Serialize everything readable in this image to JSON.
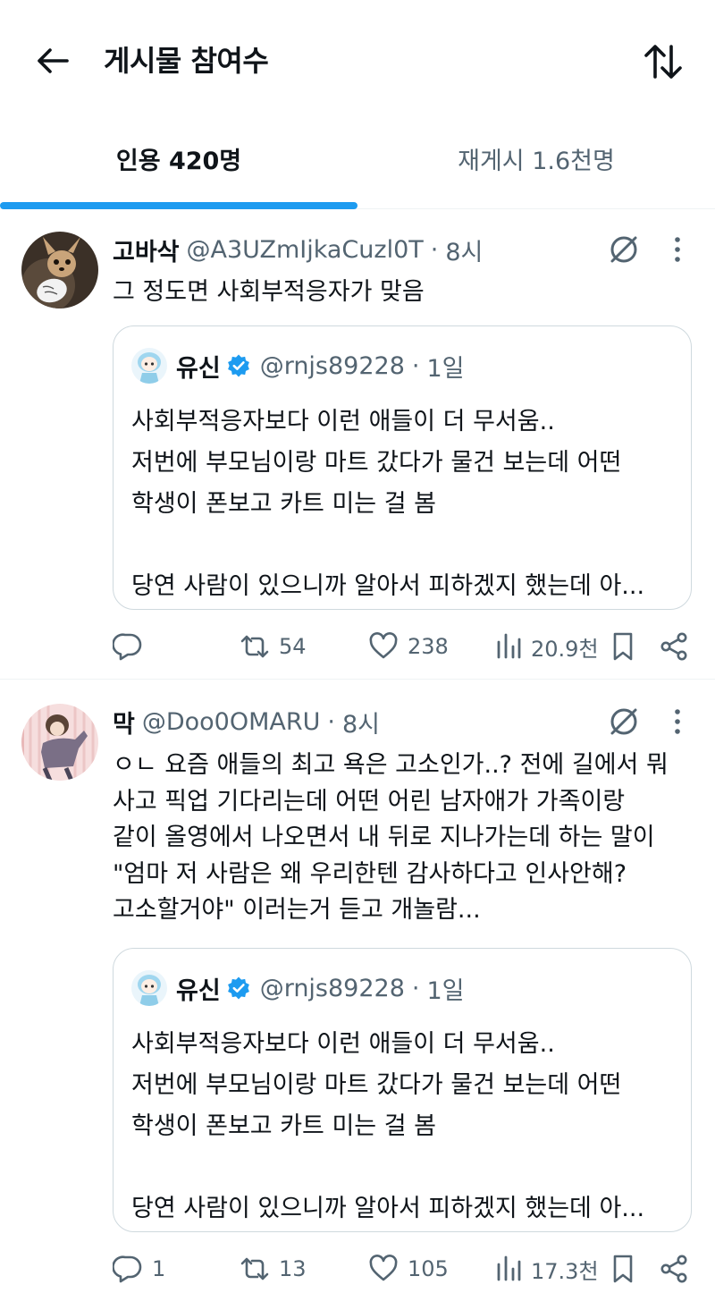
{
  "header": {
    "title": "게시물 참여수",
    "back_icon": "arrow-left-icon",
    "sort_icon": "sort-arrows-icon"
  },
  "tabs": [
    {
      "label": "인용 420명",
      "active": true
    },
    {
      "label": "재게시 1.6천명",
      "active": false
    }
  ],
  "colors": {
    "accent": "#1d9bf0",
    "text_primary": "#0f1419",
    "text_secondary": "#536471",
    "border": "#cfd9de",
    "verified": "#1d9bf0"
  },
  "posts": [
    {
      "name": "고바삭",
      "handle": "@A3UZmIjkaCuzl0T",
      "sep": "·",
      "time": "8시",
      "text": "그 정도면 사회부적응자가 맞음",
      "quote": {
        "name": "유신",
        "verified": true,
        "handle": "@rnjs89228",
        "sep": "·",
        "time": "1일",
        "text": "사회부적응자보다 이런 애들이 더 무서움..\n저번에 부모님이랑 마트 갔다가 물건 보는데 어떤\n학생이 폰보고 카트 미는 걸 봄\n\n당연 사람이 있으니까 알아서 피하겠지 했는데 아..."
      },
      "actions": {
        "replies": "",
        "reposts": "54",
        "likes": "238",
        "views": "20.9천"
      }
    },
    {
      "name": "막",
      "handle": "@Doo0OMARU",
      "sep": "·",
      "time": "8시",
      "text": "ㅇㄴ 요즘 애들의 최고 욕은 고소인가..? 전에 길에서 뭐\n사고 픽업 기다리는데 어떤 어린 남자애가 가족이랑\n같이 올영에서 나오면서 내 뒤로 지나가는데 하는 말이\n\"엄마 저 사람은 왜 우리한텐 감사하다고 인사안해?\n고소할거야\" 이러는거 듣고 개놀람...",
      "quote": {
        "name": "유신",
        "verified": true,
        "handle": "@rnjs89228",
        "sep": "·",
        "time": "1일",
        "text": "사회부적응자보다 이런 애들이 더 무서움..\n저번에 부모님이랑 마트 갔다가 물건 보는데 어떤\n학생이 폰보고 카트 미는 걸 봄\n\n당연 사람이 있으니까 알아서 피하겠지 했는데 아..."
      },
      "actions": {
        "replies": "1",
        "reposts": "13",
        "likes": "105",
        "views": "17.3천"
      }
    }
  ]
}
